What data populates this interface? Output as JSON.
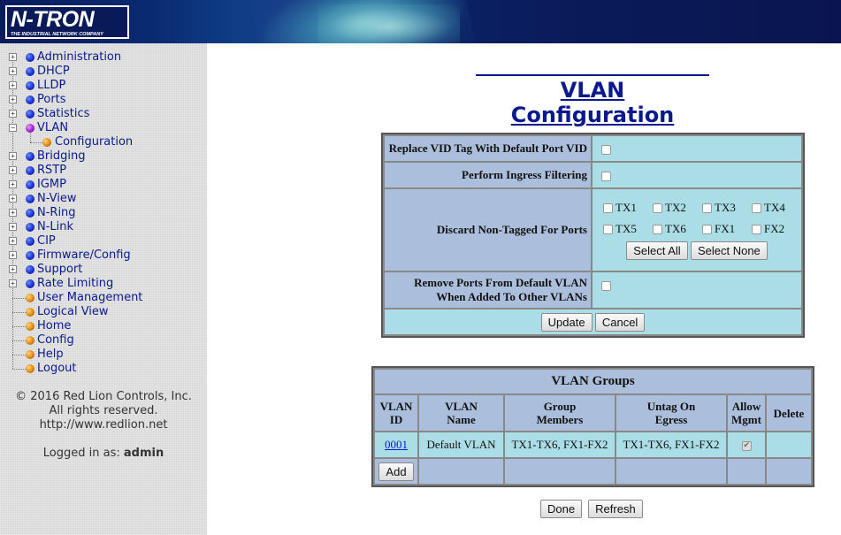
{
  "header": {
    "logo_main": "N-TRON",
    "logo_sub": "THE INDUSTRIAL NETWORK COMPANY"
  },
  "sidebar": {
    "items": [
      {
        "label": "Administration",
        "icon": "blue-dot-icon",
        "expandable": true
      },
      {
        "label": "DHCP",
        "icon": "blue-dot-icon",
        "expandable": true
      },
      {
        "label": "LLDP",
        "icon": "blue-dot-icon",
        "expandable": true
      },
      {
        "label": "Ports",
        "icon": "blue-dot-icon",
        "expandable": true
      },
      {
        "label": "Statistics",
        "icon": "blue-dot-icon",
        "expandable": true
      },
      {
        "label": "VLAN",
        "icon": "purple-dot-icon",
        "expandable": true,
        "expanded": true
      },
      {
        "label": "Configuration",
        "icon": "orange-dot-icon",
        "child": true
      },
      {
        "label": "Bridging",
        "icon": "blue-dot-icon",
        "expandable": true
      },
      {
        "label": "RSTP",
        "icon": "blue-dot-icon",
        "expandable": true
      },
      {
        "label": "IGMP",
        "icon": "blue-dot-icon",
        "expandable": true
      },
      {
        "label": "N-View",
        "icon": "blue-dot-icon",
        "expandable": true
      },
      {
        "label": "N-Ring",
        "icon": "blue-dot-icon",
        "expandable": true
      },
      {
        "label": "N-Link",
        "icon": "blue-dot-icon",
        "expandable": true
      },
      {
        "label": "CIP",
        "icon": "blue-dot-icon",
        "expandable": true
      },
      {
        "label": "Firmware/Config",
        "icon": "blue-dot-icon",
        "expandable": true
      },
      {
        "label": "Support",
        "icon": "blue-dot-icon",
        "expandable": true
      },
      {
        "label": "Rate Limiting",
        "icon": "blue-dot-icon",
        "expandable": true
      },
      {
        "label": "User Management",
        "icon": "orange-dot-icon"
      },
      {
        "label": "Logical View",
        "icon": "orange-dot-icon"
      },
      {
        "label": "Home",
        "icon": "orange-dot-icon"
      },
      {
        "label": "Config",
        "icon": "orange-dot-icon"
      },
      {
        "label": "Help",
        "icon": "orange-dot-icon"
      },
      {
        "label": "Logout",
        "icon": "orange-dot-icon"
      }
    ],
    "copyright_line1": "© 2016 Red Lion Controls, Inc.",
    "copyright_line2": "All rights reserved.",
    "copyright_line3": "http://www.redlion.net",
    "logged_prefix": "Logged in as:",
    "logged_user": "admin"
  },
  "main": {
    "title": "VLAN Configuration",
    "config": {
      "replace_vid_label": "Replace VID Tag With Default Port VID",
      "replace_vid_checked": false,
      "ingress_label": "Perform Ingress Filtering",
      "ingress_checked": false,
      "discard_label": "Discard Non-Tagged For Ports",
      "ports": [
        {
          "label": "TX1",
          "checked": false
        },
        {
          "label": "TX2",
          "checked": false
        },
        {
          "label": "TX3",
          "checked": false
        },
        {
          "label": "TX4",
          "checked": false
        },
        {
          "label": "TX5",
          "checked": false
        },
        {
          "label": "TX6",
          "checked": false
        },
        {
          "label": "FX1",
          "checked": false
        },
        {
          "label": "FX2",
          "checked": false
        }
      ],
      "select_all": "Select All",
      "select_none": "Select None",
      "remove_ports_line1": "Remove Ports From Default VLAN",
      "remove_ports_line2": "When Added To Other VLANs",
      "remove_ports_checked": false,
      "update": "Update",
      "cancel": "Cancel"
    },
    "groups": {
      "title": "VLAN Groups",
      "headers": {
        "vlan_id_1": "VLAN",
        "vlan_id_2": "ID",
        "vlan_name_1": "VLAN",
        "vlan_name_2": "Name",
        "members_1": "Group",
        "members_2": "Members",
        "untag_1": "Untag On",
        "untag_2": "Egress",
        "mgmt_1": "Allow",
        "mgmt_2": "Mgmt",
        "delete": "Delete"
      },
      "rows": [
        {
          "id": "0001",
          "name": "Default VLAN",
          "members": "TX1-TX6, FX1-FX2",
          "untag": "TX1-TX6, FX1-FX2",
          "allow_mgmt": true
        }
      ],
      "add": "Add"
    },
    "done": "Done",
    "refresh": "Refresh"
  }
}
